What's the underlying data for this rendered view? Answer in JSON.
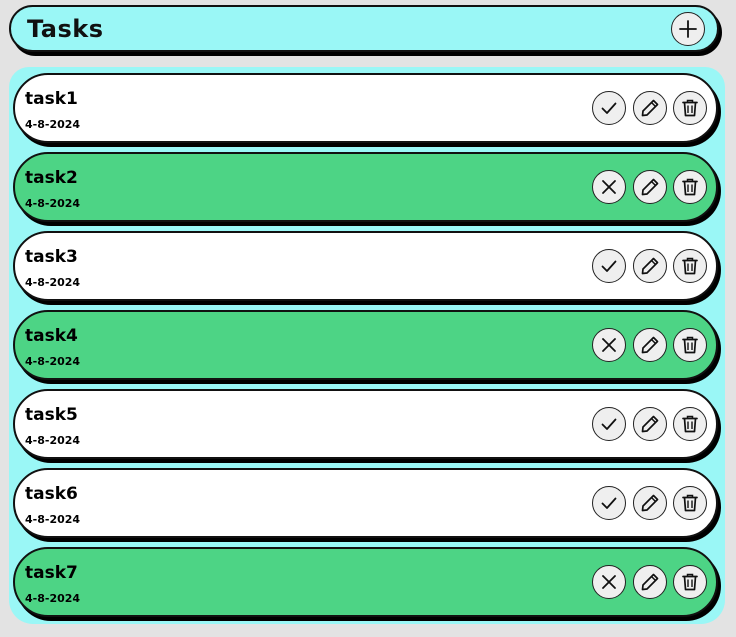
{
  "header": {
    "title": "Tasks",
    "add_icon": "plus-icon"
  },
  "colors": {
    "panel": "#9af7f6",
    "done": "#4dd485",
    "pending": "#ffffff",
    "button": "#efefef"
  },
  "tasks": [
    {
      "name": "task1",
      "date": "4-8-2024",
      "completed": false,
      "status_icon": "checkmark-icon"
    },
    {
      "name": "task2",
      "date": "4-8-2024",
      "completed": true,
      "status_icon": "close-icon"
    },
    {
      "name": "task3",
      "date": "4-8-2024",
      "completed": false,
      "status_icon": "checkmark-icon"
    },
    {
      "name": "task4",
      "date": "4-8-2024",
      "completed": true,
      "status_icon": "close-icon"
    },
    {
      "name": "task5",
      "date": "4-8-2024",
      "completed": false,
      "status_icon": "checkmark-icon"
    },
    {
      "name": "task6",
      "date": "4-8-2024",
      "completed": false,
      "status_icon": "checkmark-icon"
    },
    {
      "name": "task7",
      "date": "4-8-2024",
      "completed": true,
      "status_icon": "close-icon"
    }
  ],
  "task_actions": {
    "edit_icon": "pencil-icon",
    "delete_icon": "trash-icon"
  }
}
